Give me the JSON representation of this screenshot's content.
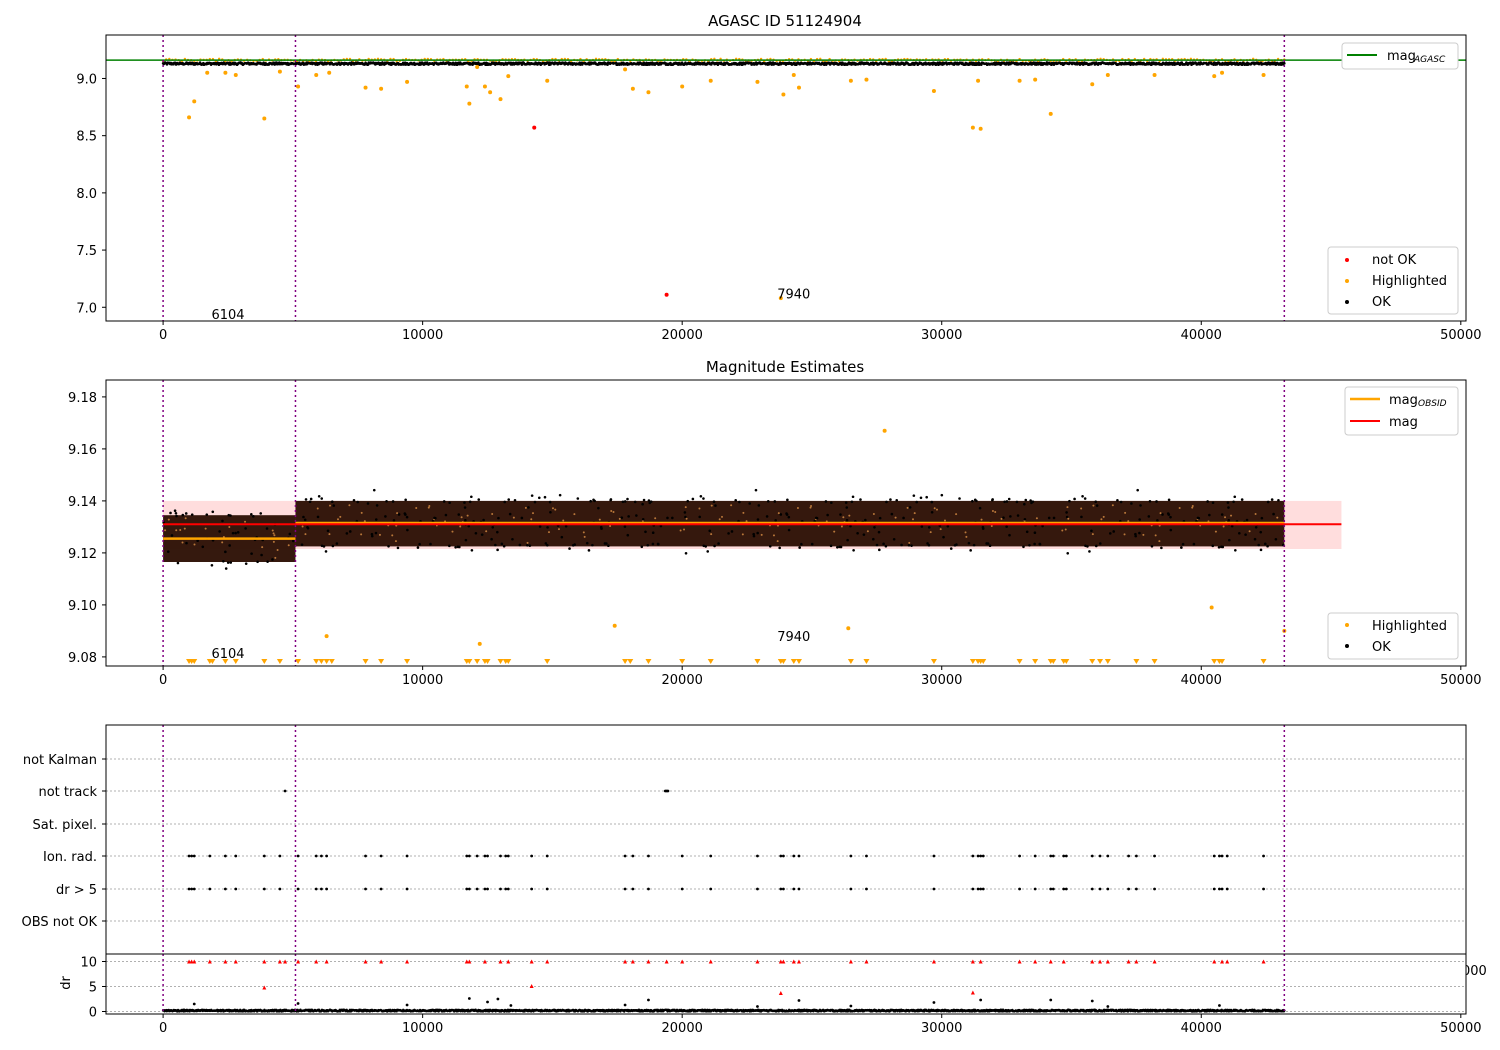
{
  "chart_data": [
    {
      "type": "scatter",
      "title": "AGASC ID 51124904",
      "xlim": [
        -2200,
        50200
      ],
      "ylim": [
        6.88,
        9.38
      ],
      "xticks": [
        0,
        10000,
        20000,
        30000,
        40000,
        50000
      ],
      "xtick_labels": [
        "0",
        "10000",
        "20000",
        "30000",
        "40000",
        "50000"
      ],
      "yticks": [
        7.0,
        7.5,
        8.0,
        8.5,
        9.0
      ],
      "ytick_labels": [
        "7.0",
        "7.5",
        "8.0",
        "8.5",
        "9.0"
      ],
      "obs_boundaries": [
        0,
        5100,
        43200
      ],
      "obs_labels": [
        {
          "text": "6104",
          "x": 2500,
          "y": 6.94
        },
        {
          "text": "7940",
          "x": 24300,
          "y": 7.12
        }
      ],
      "hlines": [
        {
          "name": "mag_AGASC",
          "label": "mag",
          "sub": "AGASC",
          "y": 9.16,
          "color": "#008000"
        }
      ],
      "band": {
        "y_center": 9.13,
        "y_spread": 0.022,
        "color": "#000000"
      },
      "series": [
        {
          "name": "not OK",
          "color": "#ff0000",
          "points": [
            [
              14300,
              8.57
            ],
            [
              19400,
              7.11
            ]
          ]
        },
        {
          "name": "Highlighted",
          "color": "#ffa500",
          "points": [
            [
              1000,
              8.66
            ],
            [
              1200,
              8.8
            ],
            [
              1700,
              9.05
            ],
            [
              2400,
              9.05
            ],
            [
              2800,
              9.03
            ],
            [
              3900,
              8.65
            ],
            [
              4500,
              9.06
            ],
            [
              5200,
              8.93
            ],
            [
              5900,
              9.03
            ],
            [
              6400,
              9.05
            ],
            [
              7800,
              8.92
            ],
            [
              8400,
              8.91
            ],
            [
              9400,
              8.97
            ],
            [
              11700,
              8.93
            ],
            [
              11800,
              8.78
            ],
            [
              12100,
              9.1
            ],
            [
              12400,
              8.93
            ],
            [
              12600,
              8.88
            ],
            [
              13000,
              8.82
            ],
            [
              13300,
              9.02
            ],
            [
              14800,
              8.98
            ],
            [
              17800,
              9.08
            ],
            [
              18100,
              8.91
            ],
            [
              18700,
              8.88
            ],
            [
              20000,
              8.93
            ],
            [
              21100,
              8.98
            ],
            [
              22900,
              8.97
            ],
            [
              23800,
              7.08
            ],
            [
              23900,
              8.86
            ],
            [
              24300,
              9.03
            ],
            [
              24500,
              8.92
            ],
            [
              26500,
              8.98
            ],
            [
              27100,
              8.99
            ],
            [
              29700,
              8.89
            ],
            [
              31200,
              8.57
            ],
            [
              31500,
              8.56
            ],
            [
              31400,
              8.98
            ],
            [
              33000,
              8.98
            ],
            [
              33600,
              8.99
            ],
            [
              34200,
              8.69
            ],
            [
              35800,
              8.95
            ],
            [
              36400,
              9.03
            ],
            [
              38200,
              9.03
            ],
            [
              40500,
              9.02
            ],
            [
              40800,
              9.05
            ],
            [
              42400,
              9.03
            ]
          ]
        },
        {
          "name": "OK",
          "color": "#000000",
          "points": []
        }
      ],
      "legend": {
        "position": "lower right",
        "entries": [
          "not OK",
          "Highlighted",
          "OK"
        ]
      },
      "line_legend": {
        "position": "upper right"
      }
    },
    {
      "type": "scatter",
      "title": "Magnitude Estimates",
      "xlim": [
        -2200,
        50200
      ],
      "ylim": [
        9.0765,
        9.1865
      ],
      "xticks": [
        0,
        10000,
        20000,
        30000,
        40000,
        50000
      ],
      "xtick_labels": [
        "0",
        "10000",
        "20000",
        "30000",
        "40000",
        "50000"
      ],
      "yticks": [
        9.08,
        9.1,
        9.12,
        9.14,
        9.16,
        9.18
      ],
      "ytick_labels": [
        "9.08",
        "9.10",
        "9.12",
        "9.14",
        "9.16",
        "9.18"
      ],
      "obs_boundaries": [
        0,
        5100,
        43200
      ],
      "obs_labels": [
        {
          "text": "6104",
          "x": 2500,
          "y": 9.0815
        },
        {
          "text": "7940",
          "x": 24300,
          "y": 9.088
        }
      ],
      "mag": {
        "label": "mag",
        "value": 9.131,
        "band": [
          9.1215,
          9.14
        ],
        "x_range": [
          0,
          45400
        ],
        "color": "#ff0000"
      },
      "mag_obsid": [
        {
          "label": "mag",
          "sub": "OBSID",
          "x_range": [
            0,
            5100
          ],
          "value": 9.1255,
          "band": [
            9.1165,
            9.1345
          ]
        },
        {
          "label": "mag",
          "sub": "OBSID",
          "x_range": [
            5100,
            43200
          ],
          "value": 9.1315,
          "band": [
            9.1225,
            9.14
          ]
        }
      ],
      "mag_obsid_color": "#ffa500",
      "scatter_spread": {
        "obs1": [
          9.1255,
          0.0095
        ],
        "obs2": [
          9.1315,
          0.0085
        ]
      },
      "series": [
        {
          "name": "Highlighted",
          "color": "#ffa500",
          "points": [
            [
              17400,
              9.092
            ],
            [
              26400,
              9.091
            ],
            [
              27800,
              9.167
            ],
            [
              43200,
              9.09
            ],
            [
              40400,
              9.099
            ],
            [
              12200,
              9.085
            ],
            [
              6300,
              9.088
            ]
          ]
        },
        {
          "name": "OK",
          "color": "#000000",
          "points": []
        }
      ],
      "off_scale_markers": [
        1000,
        1100,
        1200,
        1800,
        1900,
        2400,
        2800,
        3900,
        4500,
        5200,
        5900,
        6100,
        6300,
        6500,
        7800,
        8400,
        9400,
        11700,
        11800,
        12100,
        12400,
        12500,
        13000,
        13200,
        13300,
        14800,
        17800,
        18000,
        18700,
        20000,
        21100,
        22900,
        23800,
        23900,
        24300,
        24500,
        26500,
        27100,
        29700,
        31200,
        31400,
        31500,
        31600,
        33000,
        33600,
        34200,
        34300,
        34700,
        34800,
        35800,
        36100,
        36400,
        37500,
        38200,
        40500,
        40700,
        40800,
        42400
      ],
      "legend": {
        "position": "lower right",
        "entries": [
          "Highlighted",
          "OK"
        ]
      },
      "line_legend": {
        "position": "upper right",
        "entries": [
          "mag_OBSID",
          "mag"
        ]
      }
    },
    {
      "type": "scatter",
      "title": "",
      "xlim": [
        -2200,
        50200
      ],
      "categories": [
        "OBS not OK",
        "dr > 5",
        "Ion. rad.",
        "Sat. pixel.",
        "not track",
        "not Kalman"
      ],
      "obs_boundaries": [
        0,
        5100,
        43200
      ],
      "events": {
        "dr > 5": [
          1000,
          1100,
          1200,
          1800,
          2400,
          2800,
          3900,
          4500,
          5200,
          5900,
          6100,
          6300,
          7800,
          8400,
          9400,
          11700,
          11800,
          12100,
          12400,
          12500,
          13000,
          13200,
          13300,
          14200,
          14800,
          17800,
          18100,
          18700,
          20000,
          21100,
          22900,
          23800,
          23900,
          24300,
          24500,
          26500,
          27100,
          29700,
          31200,
          31400,
          31500,
          31600,
          33000,
          33600,
          34200,
          34300,
          34700,
          34800,
          35800,
          36100,
          36400,
          37200,
          37500,
          38200,
          40500,
          40700,
          40800,
          41000,
          42400
        ],
        "Ion. rad.": [
          1000,
          1100,
          1200,
          1800,
          2400,
          2800,
          3900,
          4500,
          5200,
          5900,
          6100,
          6300,
          7800,
          8400,
          9400,
          11700,
          11800,
          12100,
          12400,
          12500,
          13000,
          13200,
          13300,
          14200,
          14800,
          17800,
          18100,
          18700,
          20000,
          21100,
          22900,
          23800,
          23900,
          24300,
          24500,
          26500,
          27100,
          29700,
          31200,
          31400,
          31500,
          31600,
          33000,
          33600,
          34200,
          34300,
          34700,
          34800,
          35800,
          36100,
          36400,
          37200,
          37500,
          38200,
          40500,
          40700,
          40800,
          41000,
          42400
        ],
        "not track": [
          4700,
          19350,
          19400,
          19450
        ]
      }
    },
    {
      "type": "scatter",
      "title": "",
      "ylabel": "dr",
      "xlim": [
        -2200,
        50200
      ],
      "ylim": [
        -0.5,
        11.5
      ],
      "xticks": [
        0,
        10000,
        20000,
        30000,
        40000,
        50000
      ],
      "xtick_labels": [
        "0",
        "10000",
        "20000",
        "30000",
        "40000",
        "50000"
      ],
      "yticks": [
        0,
        5,
        10
      ],
      "ytick_labels": [
        "0",
        "5",
        "10"
      ],
      "obs_boundaries": [
        0,
        5100,
        43200
      ],
      "clipped_label": "000",
      "series": [
        {
          "name": "dr > 5 (clipped)",
          "color": "#ff0000",
          "points": [
            [
              1000,
              10
            ],
            [
              1100,
              10
            ],
            [
              1200,
              10
            ],
            [
              1800,
              10
            ],
            [
              2400,
              10
            ],
            [
              2800,
              10
            ],
            [
              3900,
              10
            ],
            [
              4500,
              10
            ],
            [
              4700,
              10
            ],
            [
              5200,
              10
            ],
            [
              5900,
              10
            ],
            [
              6300,
              10
            ],
            [
              7800,
              10
            ],
            [
              8400,
              10
            ],
            [
              9400,
              10
            ],
            [
              11700,
              10
            ],
            [
              11800,
              10
            ],
            [
              12400,
              10
            ],
            [
              13000,
              10
            ],
            [
              13300,
              10
            ],
            [
              14200,
              10
            ],
            [
              14800,
              10
            ],
            [
              17800,
              10
            ],
            [
              18100,
              10
            ],
            [
              18700,
              10
            ],
            [
              19400,
              10
            ],
            [
              20000,
              10
            ],
            [
              21100,
              10
            ],
            [
              22900,
              10
            ],
            [
              23800,
              10
            ],
            [
              23900,
              10
            ],
            [
              24300,
              10
            ],
            [
              24500,
              10
            ],
            [
              26500,
              10
            ],
            [
              27100,
              10
            ],
            [
              29700,
              10
            ],
            [
              31200,
              10
            ],
            [
              31500,
              10
            ],
            [
              33000,
              10
            ],
            [
              33600,
              10
            ],
            [
              34200,
              10
            ],
            [
              34700,
              10
            ],
            [
              35800,
              10
            ],
            [
              36100,
              10
            ],
            [
              36400,
              10
            ],
            [
              37200,
              10
            ],
            [
              37500,
              10
            ],
            [
              38200,
              10
            ],
            [
              40500,
              10
            ],
            [
              40800,
              10
            ],
            [
              41000,
              10
            ],
            [
              42400,
              10
            ],
            [
              3900,
              4.8
            ],
            [
              14200,
              5.1
            ],
            [
              23800,
              3.7
            ],
            [
              31200,
              3.8
            ]
          ]
        },
        {
          "name": "dr OK",
          "color": "#000000",
          "points": [
            [
              11800,
              2.6
            ],
            [
              12500,
              1.9
            ],
            [
              12900,
              2.5
            ],
            [
              18700,
              2.3
            ],
            [
              24500,
              2.2
            ],
            [
              31500,
              2.3
            ],
            [
              34200,
              2.3
            ],
            [
              35800,
              2.1
            ],
            [
              29700,
              1.8
            ],
            [
              5200,
              1.6
            ],
            [
              9400,
              1.3
            ],
            [
              40700,
              1.2
            ],
            [
              17800,
              1.3
            ],
            [
              1200,
              1.5
            ],
            [
              13400,
              1.2
            ],
            [
              26500,
              1.1
            ],
            [
              36400,
              1.0
            ],
            [
              22900,
              1.0
            ]
          ]
        }
      ]
    }
  ]
}
